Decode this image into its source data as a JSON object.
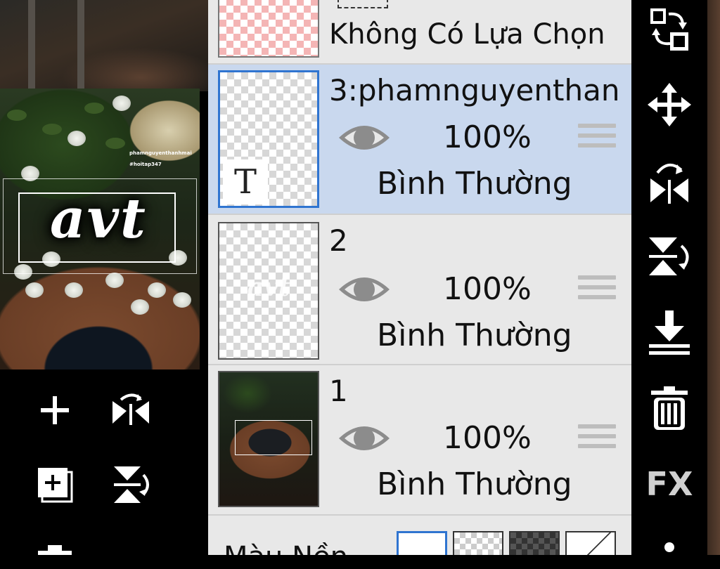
{
  "canvas": {
    "text": "avt",
    "watermark_line1": "phamnguyenthanhmai",
    "watermark_line2": "#hoitap347"
  },
  "left_toolbar": {
    "items": [
      {
        "icon": "plus-icon"
      },
      {
        "icon": "flip-horizontal-icon"
      },
      {
        "icon": "duplicate-layer-icon"
      },
      {
        "icon": "flip-vertical-icon"
      },
      {
        "icon": "camera-icon"
      }
    ]
  },
  "layers": {
    "top_partial": {
      "name": "Không Có Lựa Chọn"
    },
    "rows": [
      {
        "name": "3:phamnguyenthan",
        "opacity": "100%",
        "blend": "Bình Thường",
        "selected": true,
        "thumb_label": "T"
      },
      {
        "name": "2",
        "opacity": "100%",
        "blend": "Bình Thường",
        "selected": false,
        "thumb_label": "avt"
      },
      {
        "name": "1",
        "opacity": "100%",
        "blend": "Bình Thường",
        "selected": false
      }
    ],
    "background_label": "Màu Nền"
  },
  "right_toolbar": {
    "items": [
      {
        "icon": "swap-layers-icon"
      },
      {
        "icon": "move-icon"
      },
      {
        "icon": "flip-horizontal-icon"
      },
      {
        "icon": "flip-vertical-icon"
      },
      {
        "icon": "merge-down-icon"
      },
      {
        "icon": "trash-icon"
      },
      {
        "icon": "fx-icon",
        "label": "FX"
      },
      {
        "icon": "more-icon"
      }
    ]
  },
  "colors": {
    "selected_row": "#c9d8ee",
    "selected_border": "#2f74d0",
    "panel_bg": "#e8e8e8",
    "toolbar_bg": "#000000"
  }
}
